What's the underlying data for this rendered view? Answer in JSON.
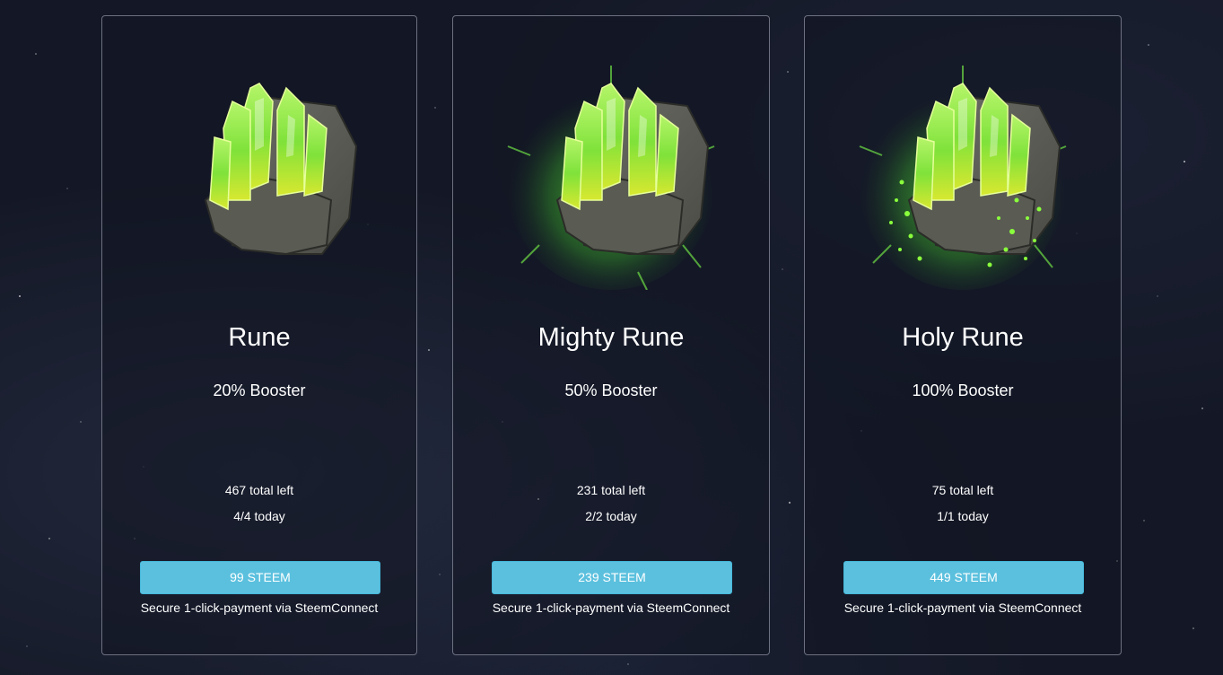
{
  "colors": {
    "background": "#141826",
    "card_border": "#6c7080",
    "button_bg": "#5bc0de",
    "crystal_green": "#7ee83a",
    "rock_gray": "#5f6059"
  },
  "cards": [
    {
      "title": "Rune",
      "booster": "20% Booster",
      "total_left": "467 total left",
      "today": "4/4 today",
      "price_label": "99 STEEM",
      "payment_note": "Secure 1-click-payment via SteemConnect",
      "icon": "rune-crystal-icon"
    },
    {
      "title": "Mighty Rune",
      "booster": "50% Booster",
      "total_left": "231 total left",
      "today": "2/2 today",
      "price_label": "239 STEEM",
      "payment_note": "Secure 1-click-payment via SteemConnect",
      "icon": "mighty-rune-crystal-icon"
    },
    {
      "title": "Holy Rune",
      "booster": "100% Booster",
      "total_left": "75 total left",
      "today": "1/1 today",
      "price_label": "449 STEEM",
      "payment_note": "Secure 1-click-payment via SteemConnect",
      "icon": "holy-rune-crystal-icon"
    }
  ]
}
